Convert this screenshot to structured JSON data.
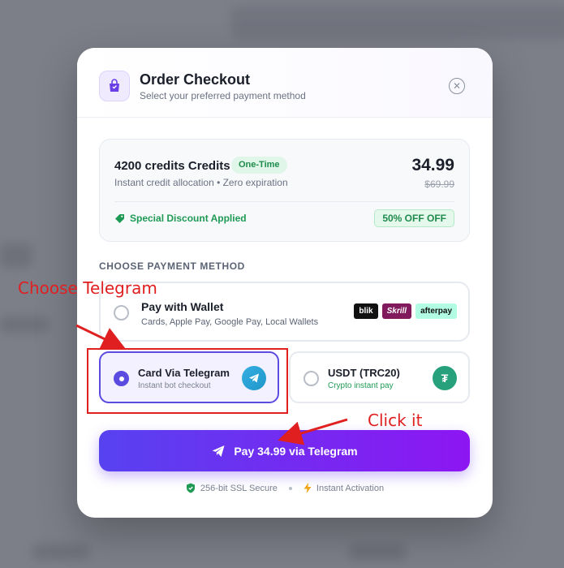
{
  "modal": {
    "title": "Order Checkout",
    "subtitle": "Select your preferred payment method",
    "close_icon": "close-icon"
  },
  "summary": {
    "product_name": "4200 credits Credits",
    "badge": "One-Time",
    "description": "Instant credit allocation • Zero expiration",
    "price": "34.99",
    "old_price": "$69.99",
    "discount_label": "Special Discount Applied",
    "discount_badge": "50% OFF OFF"
  },
  "payment": {
    "section_label": "CHOOSE PAYMENT METHOD",
    "wallet": {
      "title": "Pay with Wallet",
      "subtitle": "Cards, Apple Pay, Google Pay, Local Wallets",
      "logos": [
        "blik",
        "Skrill",
        "afterpay"
      ],
      "selected": false
    },
    "telegram": {
      "title": "Card Via Telegram",
      "subtitle": "Instant bot checkout",
      "selected": true
    },
    "usdt": {
      "title": "USDT (TRC20)",
      "subtitle": "Crypto instant pay",
      "icon_glyph": "₮",
      "selected": false
    }
  },
  "pay_button": {
    "label": "Pay 34.99 via Telegram"
  },
  "footer": {
    "ssl": "256-bit SSL Secure",
    "instant": "Instant Activation"
  },
  "annotations": {
    "choose": "Choose Telegram",
    "click": "Click it",
    "color": "#e02020"
  },
  "colors": {
    "accent": "#5b4be0",
    "gradient_start": "#5742f0",
    "gradient_end": "#8d16f2",
    "success": "#1f9a55"
  }
}
